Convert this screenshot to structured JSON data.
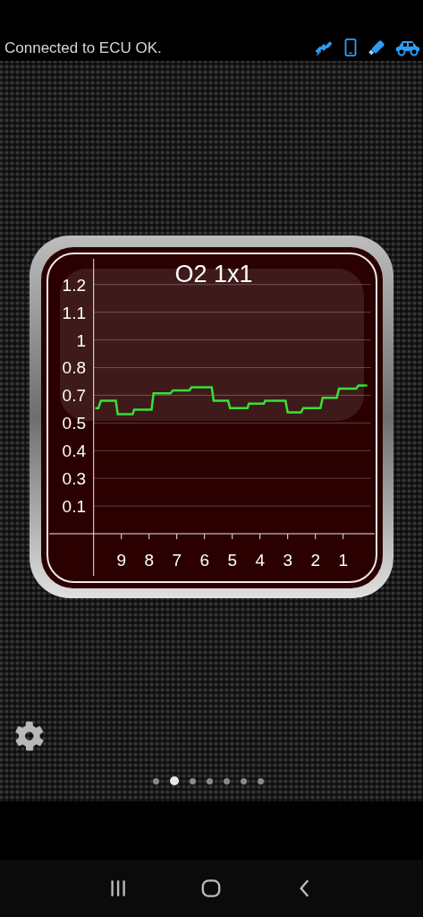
{
  "status": {
    "text": "Connected to ECU OK."
  },
  "gauge": {
    "chart_data": {
      "type": "line",
      "title": "O2 1x1",
      "x": [
        9.94,
        9.83,
        9.74,
        9.2,
        9.13,
        8.59,
        8.54,
        7.91,
        7.84,
        7.23,
        7.14,
        6.55,
        6.47,
        5.74,
        5.67,
        5.15,
        5.08,
        4.45,
        4.4,
        3.86,
        3.81,
        3.08,
        3.0,
        2.52,
        2.44,
        1.82,
        1.74,
        1.23,
        1.15,
        0.53,
        0.45,
        0.13
      ],
      "series": [
        {
          "color": "#22dd22",
          "values": [
            0.605,
            0.605,
            0.64,
            0.64,
            0.575,
            0.575,
            0.597,
            0.597,
            0.676,
            0.676,
            0.69,
            0.69,
            0.705,
            0.705,
            0.64,
            0.64,
            0.605,
            0.605,
            0.626,
            0.626,
            0.64,
            0.64,
            0.584,
            0.584,
            0.605,
            0.605,
            0.654,
            0.654,
            0.699,
            0.699,
            0.713,
            0.713
          ]
        }
      ],
      "grid": true,
      "xlim": [
        10,
        0
      ],
      "ylim": [
        0,
        1.2
      ],
      "xticks": [
        9,
        8,
        7,
        6,
        5,
        4,
        3,
        2,
        1
      ],
      "yticks": [
        {
          "value": 0.1333,
          "label": "0.1"
        },
        {
          "value": 0.2667,
          "label": "0.3"
        },
        {
          "value": 0.4,
          "label": "0.4"
        },
        {
          "value": 0.5333,
          "label": "0.5"
        },
        {
          "value": 0.6667,
          "label": "0.7"
        },
        {
          "value": 0.8,
          "label": "0.8"
        },
        {
          "value": 0.9333,
          "label": "1"
        },
        {
          "value": 1.0667,
          "label": "1.1"
        },
        {
          "value": 1.2,
          "label": "1.2"
        }
      ]
    }
  },
  "pager": [
    {
      "selected": false
    },
    {
      "selected": true
    },
    {
      "selected": false
    },
    {
      "selected": false
    },
    {
      "selected": false
    },
    {
      "selected": false
    },
    {
      "selected": false
    }
  ]
}
